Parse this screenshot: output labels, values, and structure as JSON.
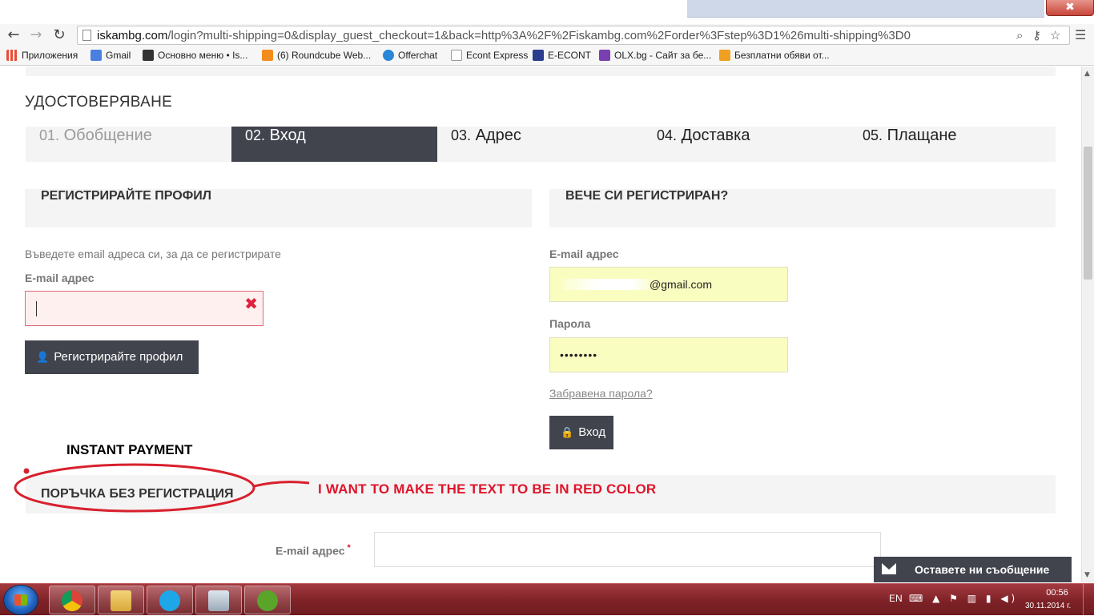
{
  "browser": {
    "close_glyph": "✖",
    "url": "iskambg.com/login?multi-shipping=0&display_guest_checkout=1&back=http%3A%2F%2Fiskambg.com%2Forder%3Fstep%3D1%26multi-shipping%3D0",
    "url_domain": "iskambg.com",
    "url_rest": "/login?multi-shipping=0&display_guest_checkout=1&back=http%3A%2F%2Fiskambg.com%2Forder%3Fstep%3D1%26multi-shipping%3D0",
    "bookmarks": [
      {
        "label": "Приложения",
        "icon": "apps-grid-icon",
        "color": "#e94b35"
      },
      {
        "label": "Gmail",
        "icon": "google-icon",
        "color": "#4a7fe0"
      },
      {
        "label": "Основно меню • Is...",
        "icon": "page-icon",
        "color": "#333333"
      },
      {
        "label": "(6) Roundcube Web...",
        "icon": "cpanel-icon",
        "color": "#f28c1a"
      },
      {
        "label": "Offerchat",
        "icon": "offerchat-icon",
        "color": "#2a86d6"
      },
      {
        "label": "Econt Express",
        "icon": "page-icon",
        "color": "#dddddd"
      },
      {
        "label": "E-ECONT",
        "icon": "econt-icon",
        "color": "#2a3d8f"
      },
      {
        "label": "OLX.bg - Сайт за бе...",
        "icon": "olx-icon",
        "color": "#7a3fb0"
      },
      {
        "label": "Безплатни обяви от...",
        "icon": "bazar-icon",
        "color": "#f0a020"
      }
    ]
  },
  "page": {
    "section_title": "УДОСТОВЕРЯВАНЕ",
    "steps": [
      {
        "num": "01.",
        "label": "Обобщение",
        "state": "done"
      },
      {
        "num": "02.",
        "label": "Вход",
        "state": "active"
      },
      {
        "num": "03.",
        "label": "Адрес",
        "state": "pending"
      },
      {
        "num": "04.",
        "label": "Доставка",
        "state": "pending"
      },
      {
        "num": "05.",
        "label": "Плащане",
        "state": "pending"
      }
    ],
    "register": {
      "heading": "РЕГИСТРИРАЙТЕ ПРОФИЛ",
      "hint": "Въведете email адреса си, за да се регистрирате",
      "email_label": "E-mail адрес",
      "button_label": "Регистрирайте профил",
      "error_glyph": "✖"
    },
    "login": {
      "heading": "ВЕЧЕ СИ РЕГИСТРИРАН?",
      "email_label": "E-mail адрес",
      "email_value": "@gmail.com",
      "password_label": "Парола",
      "password_value": "••••••••",
      "forgot_label": "Забравена парола?",
      "button_label": "Вход"
    },
    "guest": {
      "heading": "ПОРЪЧКА БЕЗ РЕГИСТРАЦИЯ",
      "email_label": "E-mail адрес",
      "required_mark": "*"
    },
    "annotations": {
      "instant_payment": "INSTANT PAYMENT",
      "red_note": "I WANT TO MAKE THE TEXT TO BE IN RED COLOR",
      "color": "#e0142a"
    },
    "chat": {
      "label": "Оставете ни съобщение"
    }
  },
  "taskbar": {
    "apps": [
      "chrome-icon",
      "explorer-icon",
      "skype-icon",
      "calculator-icon",
      "utorrent-icon"
    ],
    "lang": "EN",
    "time": "00:56",
    "date": "30.11.2014 г."
  },
  "colors": {
    "accent_dark": "#41444d",
    "panel_gray": "#f4f4f4",
    "autofill_yellow": "#fafdc0",
    "error_red": "#e0213b"
  }
}
